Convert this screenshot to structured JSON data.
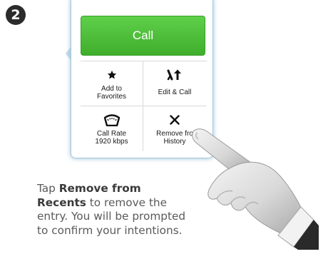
{
  "step": {
    "number": "2"
  },
  "menu": {
    "call_label": "Call",
    "items": [
      {
        "icon": "star-icon",
        "line1": "Add to",
        "line2": "Favorites"
      },
      {
        "icon": "edit-and-call-icon",
        "line1": "Edit & Call",
        "line2": ""
      },
      {
        "icon": "call-rate-gauge-icon",
        "line1": "Call Rate",
        "line2": "1920 kbps"
      },
      {
        "icon": "close-x-icon",
        "line1": "Remove fro",
        "line2": "History"
      }
    ]
  },
  "instruction": {
    "pre": "Tap ",
    "bold": "Remove from Recents",
    "post": " to remove the entry. You will be prompted to confirm your intentions."
  },
  "colors": {
    "call_green": "#47b832",
    "panel_glow": "#b8d3e3",
    "text_gray": "#5a5a5a"
  }
}
